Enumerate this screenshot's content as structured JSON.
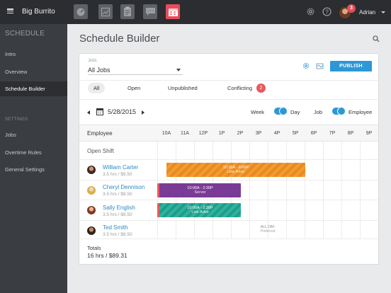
{
  "app": {
    "brand": "Big Burrito"
  },
  "topbar": {
    "apps": [
      {
        "icon": "dashboard-icon"
      },
      {
        "icon": "reports-icon"
      },
      {
        "icon": "clipboard-icon"
      },
      {
        "icon": "messages-icon"
      },
      {
        "icon": "schedule-icon",
        "active": true
      }
    ],
    "notifications": "3",
    "user": "Adrian"
  },
  "sidebar": {
    "section": "SCHEDULE",
    "items": [
      {
        "label": "Intro"
      },
      {
        "label": "Overview"
      },
      {
        "label": "Schedule Builder",
        "active": true
      }
    ],
    "settings_label": "SETTINGS",
    "settings_items": [
      {
        "label": "Jobs"
      },
      {
        "label": "Overtime Rules"
      },
      {
        "label": "General Settings"
      }
    ]
  },
  "page": {
    "title": "Schedule Builder"
  },
  "toolbar": {
    "jobs_label": "Jobs",
    "jobs_value": "All Jobs",
    "publish": "PUBLISH"
  },
  "filters": {
    "all": "All",
    "open": "Open",
    "unpublished": "Unpublished",
    "conflicting": "Conflicting",
    "conflict_count": "2"
  },
  "datebar": {
    "date": "5/28/2015",
    "week": "Week",
    "day": "Day",
    "job": "Job",
    "employee": "Employee"
  },
  "grid": {
    "employee_header": "Employee",
    "hours": [
      "10A",
      "11A",
      "12P",
      "1P",
      "2P",
      "3P",
      "4P",
      "5P",
      "6P",
      "7P",
      "8P",
      "9P"
    ],
    "open_shift": "Open Shift",
    "employees": [
      {
        "name": "William Carter",
        "sub": "3.5 hrs / $9.50",
        "shift": {
          "time": "10:30A - 6:00P",
          "role": "Line Artist",
          "color": "#ea8a1c"
        }
      },
      {
        "name": "Cheryl Dennison",
        "sub": "3.5 hrs / $9.50",
        "shift": {
          "time": "10:00A - 2:30P",
          "role": "Server",
          "color": "#7a3b96"
        }
      },
      {
        "name": "Sally English",
        "sub": "3.5 hrs / $9.50",
        "shift": {
          "time": "10:00A - 2:30P",
          "role": "Line Artist",
          "color": "#1f9c8a"
        }
      },
      {
        "name": "Ted Smith",
        "sub": "3.5 hrs / $9.50",
        "shift": {
          "time": "ALL DAY",
          "role": "Preferred"
        }
      }
    ]
  },
  "totals": {
    "label": "Totals",
    "value": "16 hrs / $89.31"
  },
  "colors": {
    "accent": "#2e97d6",
    "alert": "#e8595f",
    "sidebar": "#3a3d42",
    "topbar": "#2b2d30"
  }
}
